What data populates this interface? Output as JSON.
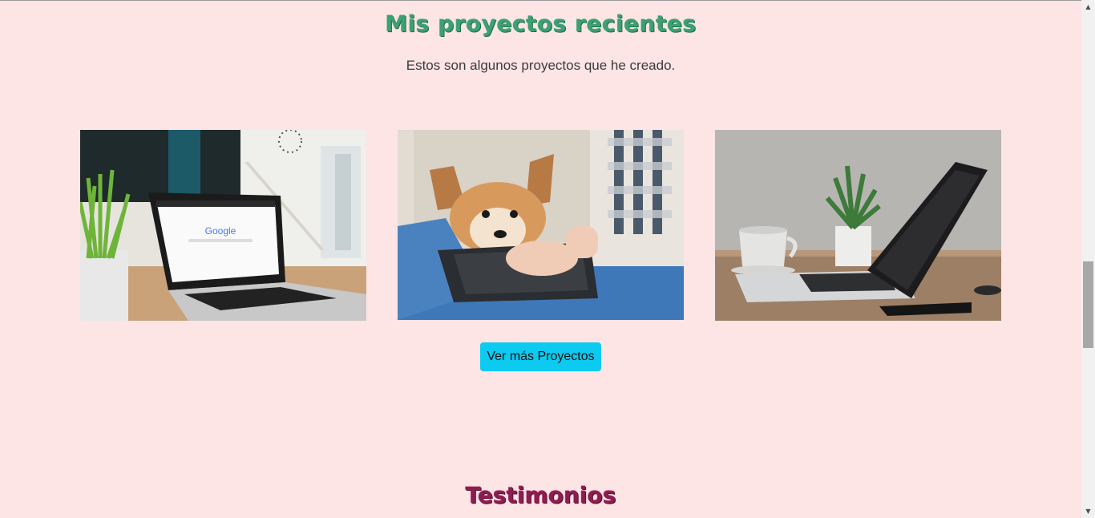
{
  "projects": {
    "title": "Mis proyectos recientes",
    "subtitle": "Estos son algunos proyectos que he creado.",
    "cards": [
      {
        "image": "laptop-google-photo",
        "screen_text": "Google"
      },
      {
        "image": "corgi-laptop-photo"
      },
      {
        "image": "laptop-plant-coffee-photo"
      }
    ],
    "more_button_label": "Ver más Proyectos"
  },
  "testimonials": {
    "title": "Testimonios"
  },
  "colors": {
    "background": "#fde4e5",
    "projects_title": "#3d9f73",
    "testimonials_title": "#8b1d4f",
    "button": "#0dcaf0"
  }
}
